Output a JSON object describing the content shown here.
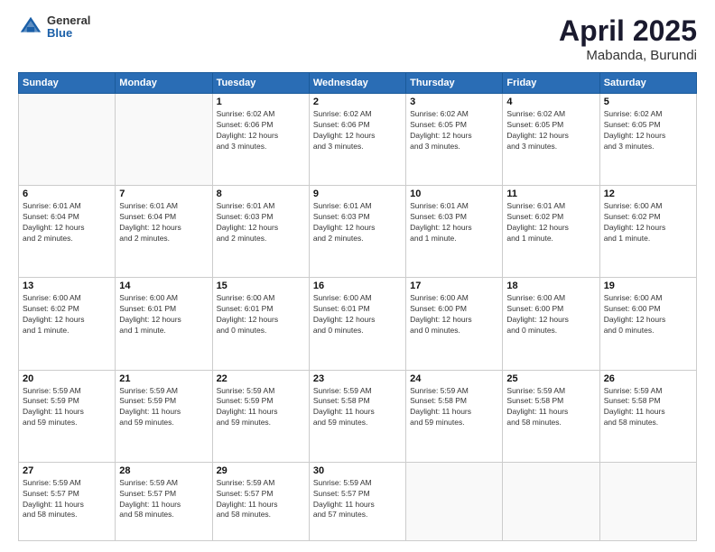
{
  "header": {
    "logo_general": "General",
    "logo_blue": "Blue",
    "title": "April 2025",
    "subtitle": "Mabanda, Burundi"
  },
  "columns": [
    "Sunday",
    "Monday",
    "Tuesday",
    "Wednesday",
    "Thursday",
    "Friday",
    "Saturday"
  ],
  "weeks": [
    [
      {
        "day": "",
        "info": ""
      },
      {
        "day": "",
        "info": ""
      },
      {
        "day": "1",
        "info": "Sunrise: 6:02 AM\nSunset: 6:06 PM\nDaylight: 12 hours\nand 3 minutes."
      },
      {
        "day": "2",
        "info": "Sunrise: 6:02 AM\nSunset: 6:06 PM\nDaylight: 12 hours\nand 3 minutes."
      },
      {
        "day": "3",
        "info": "Sunrise: 6:02 AM\nSunset: 6:05 PM\nDaylight: 12 hours\nand 3 minutes."
      },
      {
        "day": "4",
        "info": "Sunrise: 6:02 AM\nSunset: 6:05 PM\nDaylight: 12 hours\nand 3 minutes."
      },
      {
        "day": "5",
        "info": "Sunrise: 6:02 AM\nSunset: 6:05 PM\nDaylight: 12 hours\nand 3 minutes."
      }
    ],
    [
      {
        "day": "6",
        "info": "Sunrise: 6:01 AM\nSunset: 6:04 PM\nDaylight: 12 hours\nand 2 minutes."
      },
      {
        "day": "7",
        "info": "Sunrise: 6:01 AM\nSunset: 6:04 PM\nDaylight: 12 hours\nand 2 minutes."
      },
      {
        "day": "8",
        "info": "Sunrise: 6:01 AM\nSunset: 6:03 PM\nDaylight: 12 hours\nand 2 minutes."
      },
      {
        "day": "9",
        "info": "Sunrise: 6:01 AM\nSunset: 6:03 PM\nDaylight: 12 hours\nand 2 minutes."
      },
      {
        "day": "10",
        "info": "Sunrise: 6:01 AM\nSunset: 6:03 PM\nDaylight: 12 hours\nand 1 minute."
      },
      {
        "day": "11",
        "info": "Sunrise: 6:01 AM\nSunset: 6:02 PM\nDaylight: 12 hours\nand 1 minute."
      },
      {
        "day": "12",
        "info": "Sunrise: 6:00 AM\nSunset: 6:02 PM\nDaylight: 12 hours\nand 1 minute."
      }
    ],
    [
      {
        "day": "13",
        "info": "Sunrise: 6:00 AM\nSunset: 6:02 PM\nDaylight: 12 hours\nand 1 minute."
      },
      {
        "day": "14",
        "info": "Sunrise: 6:00 AM\nSunset: 6:01 PM\nDaylight: 12 hours\nand 1 minute."
      },
      {
        "day": "15",
        "info": "Sunrise: 6:00 AM\nSunset: 6:01 PM\nDaylight: 12 hours\nand 0 minutes."
      },
      {
        "day": "16",
        "info": "Sunrise: 6:00 AM\nSunset: 6:01 PM\nDaylight: 12 hours\nand 0 minutes."
      },
      {
        "day": "17",
        "info": "Sunrise: 6:00 AM\nSunset: 6:00 PM\nDaylight: 12 hours\nand 0 minutes."
      },
      {
        "day": "18",
        "info": "Sunrise: 6:00 AM\nSunset: 6:00 PM\nDaylight: 12 hours\nand 0 minutes."
      },
      {
        "day": "19",
        "info": "Sunrise: 6:00 AM\nSunset: 6:00 PM\nDaylight: 12 hours\nand 0 minutes."
      }
    ],
    [
      {
        "day": "20",
        "info": "Sunrise: 5:59 AM\nSunset: 5:59 PM\nDaylight: 11 hours\nand 59 minutes."
      },
      {
        "day": "21",
        "info": "Sunrise: 5:59 AM\nSunset: 5:59 PM\nDaylight: 11 hours\nand 59 minutes."
      },
      {
        "day": "22",
        "info": "Sunrise: 5:59 AM\nSunset: 5:59 PM\nDaylight: 11 hours\nand 59 minutes."
      },
      {
        "day": "23",
        "info": "Sunrise: 5:59 AM\nSunset: 5:58 PM\nDaylight: 11 hours\nand 59 minutes."
      },
      {
        "day": "24",
        "info": "Sunrise: 5:59 AM\nSunset: 5:58 PM\nDaylight: 11 hours\nand 59 minutes."
      },
      {
        "day": "25",
        "info": "Sunrise: 5:59 AM\nSunset: 5:58 PM\nDaylight: 11 hours\nand 58 minutes."
      },
      {
        "day": "26",
        "info": "Sunrise: 5:59 AM\nSunset: 5:58 PM\nDaylight: 11 hours\nand 58 minutes."
      }
    ],
    [
      {
        "day": "27",
        "info": "Sunrise: 5:59 AM\nSunset: 5:57 PM\nDaylight: 11 hours\nand 58 minutes."
      },
      {
        "day": "28",
        "info": "Sunrise: 5:59 AM\nSunset: 5:57 PM\nDaylight: 11 hours\nand 58 minutes."
      },
      {
        "day": "29",
        "info": "Sunrise: 5:59 AM\nSunset: 5:57 PM\nDaylight: 11 hours\nand 58 minutes."
      },
      {
        "day": "30",
        "info": "Sunrise: 5:59 AM\nSunset: 5:57 PM\nDaylight: 11 hours\nand 57 minutes."
      },
      {
        "day": "",
        "info": ""
      },
      {
        "day": "",
        "info": ""
      },
      {
        "day": "",
        "info": ""
      }
    ]
  ]
}
